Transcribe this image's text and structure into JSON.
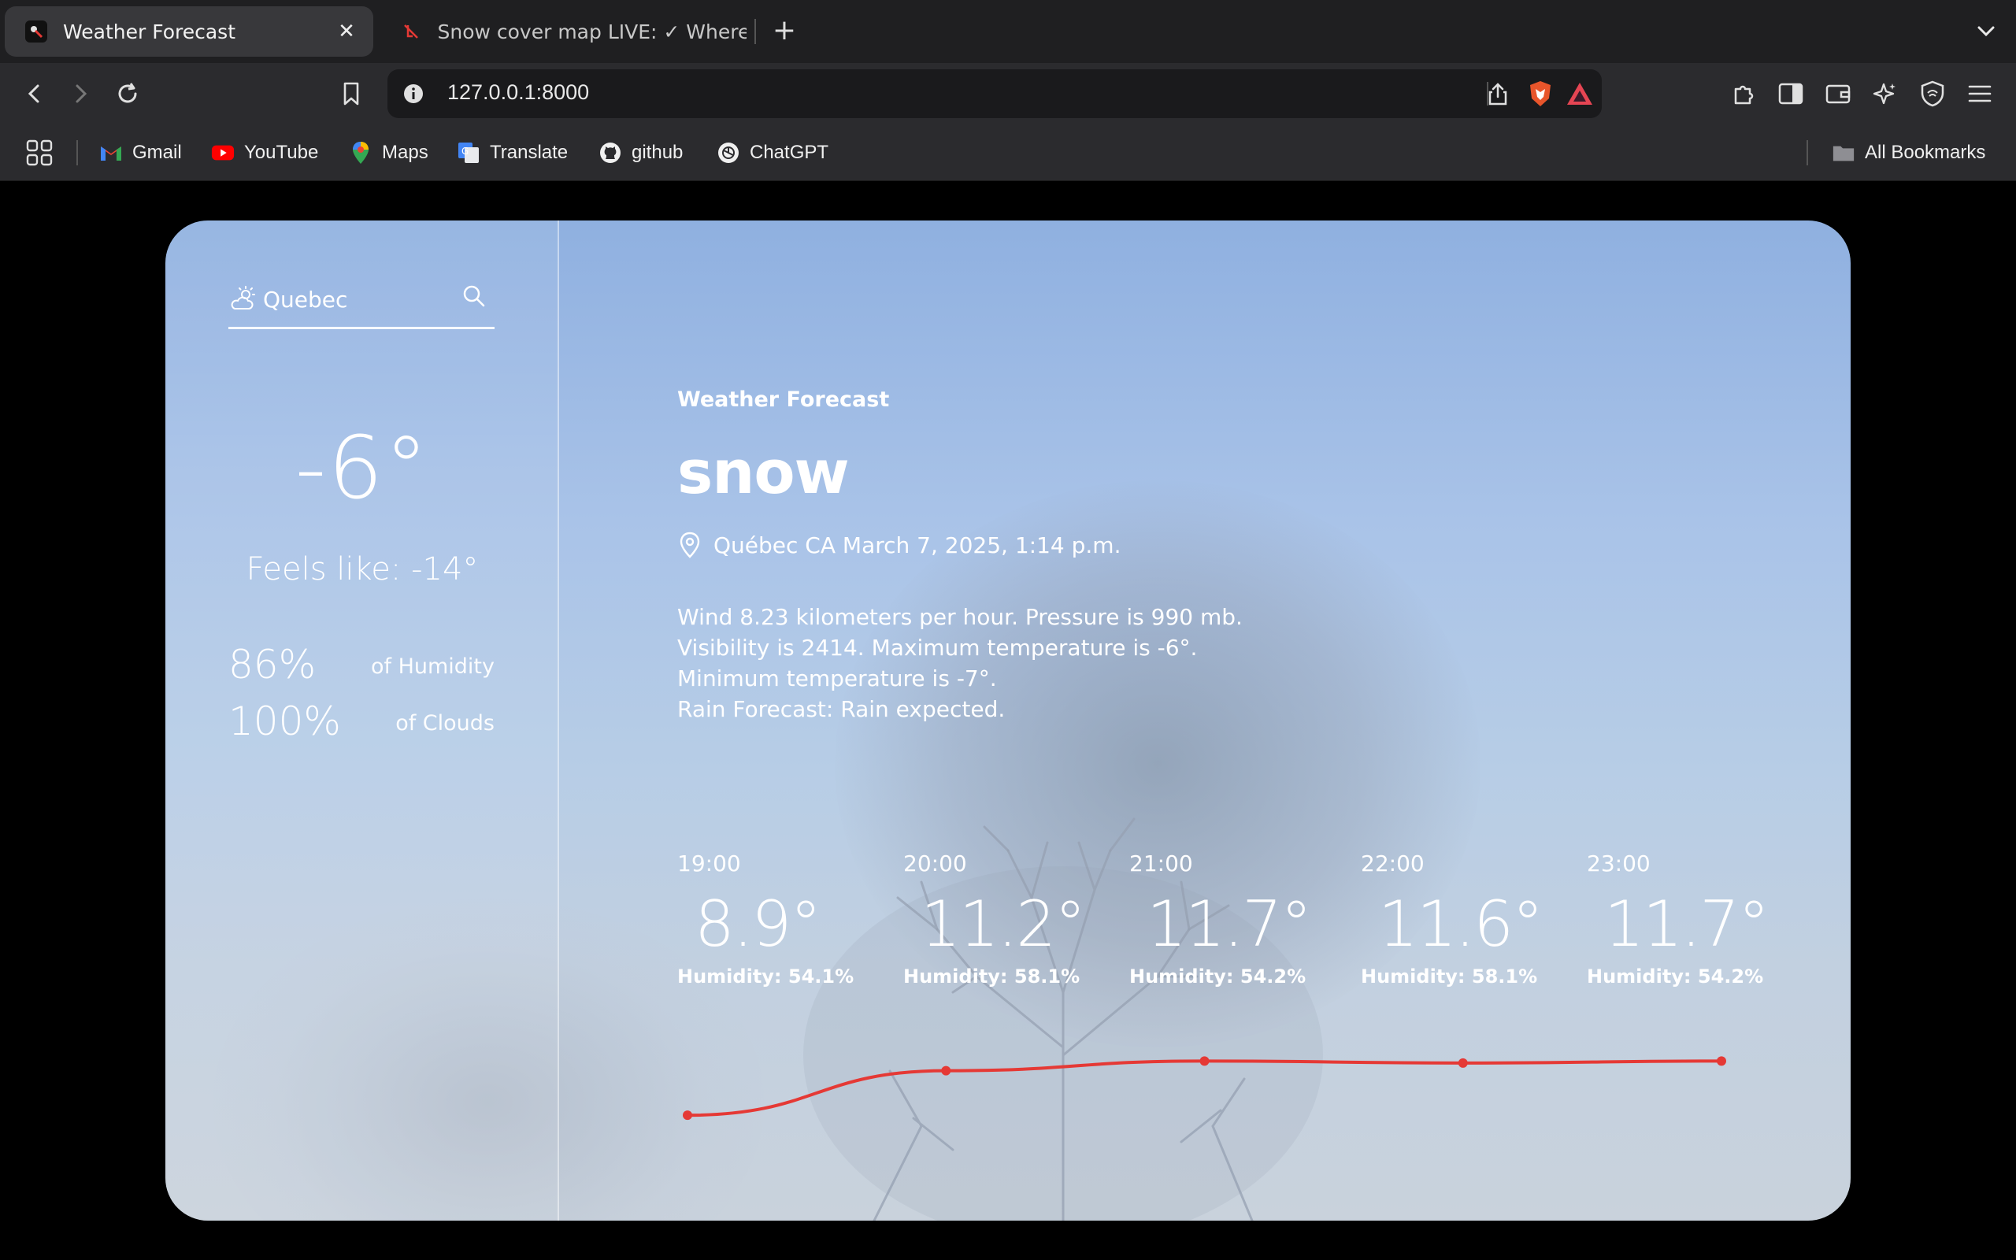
{
  "browser": {
    "tabs": [
      {
        "title": "Weather Forecast",
        "active": true
      },
      {
        "title": "Snow cover map LIVE: ✓ Where i"
      }
    ],
    "url": "127.0.0.1:8000",
    "bookmarks": [
      {
        "label": "Gmail",
        "icon": "gmail-icon"
      },
      {
        "label": "YouTube",
        "icon": "youtube-icon"
      },
      {
        "label": "Maps",
        "icon": "maps-icon"
      },
      {
        "label": "Translate",
        "icon": "translate-icon"
      },
      {
        "label": "github",
        "icon": "github-icon"
      },
      {
        "label": "ChatGPT",
        "icon": "chatgpt-icon"
      }
    ],
    "all_bookmarks": "All Bookmarks"
  },
  "sidebar": {
    "search_value": "Quebec",
    "temperature": "-6°",
    "feels_like": "Feels like:  -14°",
    "humidity_value": "86%",
    "humidity_label": "of Humidity",
    "clouds_value": "100%",
    "clouds_label": "of Clouds"
  },
  "main": {
    "app_title": "Weather Forecast",
    "condition": "snow",
    "location": "Québec CA March 7, 2025, 1:14 p.m.",
    "description": [
      "Wind 8.23 kilometers per hour. Pressure is 990 mb.",
      "Visibility is 2414. Maximum temperature is -6°. Minimum temperature is -7°.",
      "Rain Forecast: Rain expected."
    ]
  },
  "forecast": [
    {
      "time": "19:00",
      "temp": "8.9°",
      "humidity": "Humidity: 54.1%"
    },
    {
      "time": "20:00",
      "temp": "11.2°",
      "humidity": "Humidity: 58.1%"
    },
    {
      "time": "21:00",
      "temp": "11.7°",
      "humidity": "Humidity: 54.2%"
    },
    {
      "time": "22:00",
      "temp": "11.6°",
      "humidity": "Humidity: 58.1%"
    },
    {
      "time": "23:00",
      "temp": "11.7°",
      "humidity": "Humidity: 54.2%"
    }
  ],
  "chart_data": {
    "type": "line",
    "categories": [
      "19:00",
      "20:00",
      "21:00",
      "22:00",
      "23:00"
    ],
    "values": [
      8.9,
      11.2,
      11.7,
      11.6,
      11.7
    ],
    "title": "",
    "xlabel": "",
    "ylabel": "",
    "color": "#e53935",
    "grid": false
  },
  "colors": {
    "accent_line": "#e53935",
    "chrome_bg": "#1f1f21",
    "toolbar_bg": "#2b2b2e"
  }
}
